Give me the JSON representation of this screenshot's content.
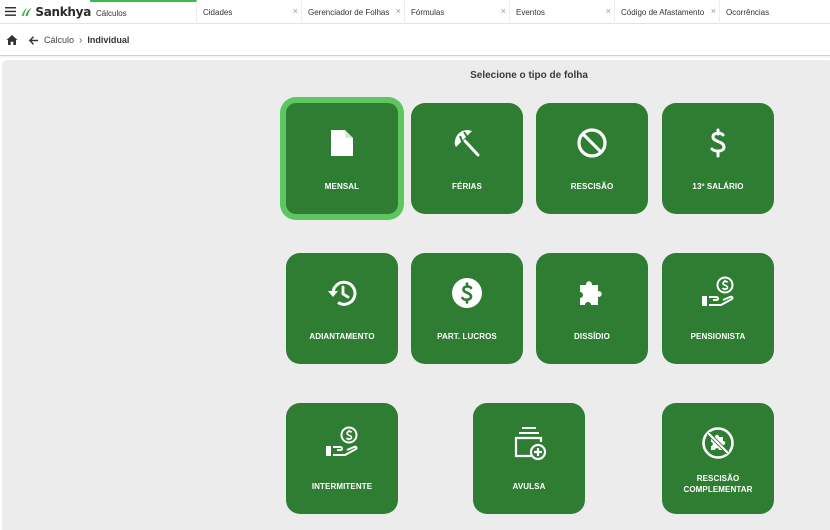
{
  "app": {
    "brand": "Sankhya"
  },
  "tabs": [
    {
      "label": "Cálculos",
      "active": true,
      "closable": false
    },
    {
      "label": "Cidades",
      "active": false,
      "closable": true
    },
    {
      "label": "Gerenciador de Folhas",
      "active": false,
      "closable": true
    },
    {
      "label": "Fórmulas",
      "active": false,
      "closable": true
    },
    {
      "label": "Eventos",
      "active": false,
      "closable": true
    },
    {
      "label": "Código de Afastamento",
      "active": false,
      "closable": true
    },
    {
      "label": "Ocorrências",
      "active": false,
      "closable": false
    }
  ],
  "tab_close_glyph": "×",
  "breadcrumb": {
    "parent": "Cálculo",
    "separator": "›",
    "current": "Individual"
  },
  "main": {
    "heading": "Selecione o tipo de folha",
    "tiles": [
      {
        "label": "MENSAL",
        "icon": "document-icon",
        "selected": true
      },
      {
        "label": "FÉRIAS",
        "icon": "beach-umbrella-icon",
        "selected": false
      },
      {
        "label": "RESCISÃO",
        "icon": "block-icon",
        "selected": false
      },
      {
        "label": "13º SALÁRIO",
        "icon": "dollar-icon",
        "selected": false
      },
      {
        "label": "ADIANTAMENTO",
        "icon": "history-icon",
        "selected": false
      },
      {
        "label": "PART. LUCROS",
        "icon": "dollar-circle-icon",
        "selected": false
      },
      {
        "label": "DISSÍDIO",
        "icon": "puzzle-icon",
        "selected": false
      },
      {
        "label": "PENSIONISTA",
        "icon": "payment-hand-icon",
        "selected": false
      },
      {
        "label": "INTERMITENTE",
        "icon": "payment-hand-icon",
        "selected": false
      },
      {
        "label": "AVULSA",
        "icon": "add-stack-icon",
        "selected": false
      },
      {
        "label": "RESCISÃO COMPLEMENTAR",
        "icon": "puzzle-blocked-icon",
        "selected": false
      }
    ]
  },
  "colors": {
    "tile": "#2e7d32",
    "selection_ring": "#5dc65f",
    "active_tab_indicator": "#3fb94a",
    "background": "#ececec"
  }
}
